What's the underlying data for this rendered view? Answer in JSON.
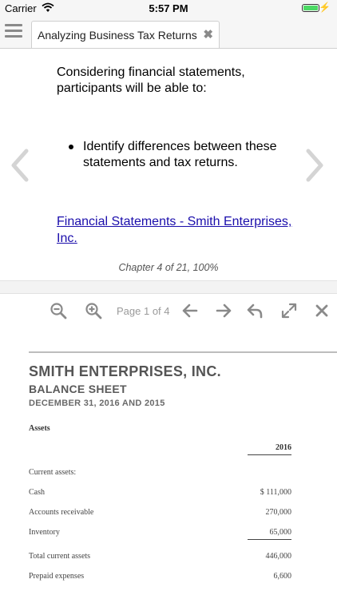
{
  "status_bar": {
    "carrier": "Carrier",
    "time": "5:57 PM",
    "charging_glyph": "⚡"
  },
  "tab_bar": {
    "tab_title": "Analyzing Business Tax Returns",
    "close_glyph": "✖"
  },
  "reader": {
    "intro": "Considering financial statements, participants will be able to:",
    "bullets": [
      "Identify differences between these statements and tax returns."
    ],
    "link_text": "Financial Statements - Smith Enterprises, Inc.",
    "chapter_info": "Chapter 4 of 21, 100%"
  },
  "pdf_toolbar": {
    "page_indicator": "Page 1 of 4"
  },
  "pdf_document": {
    "company": "SMITH ENTERPRISES, INC.",
    "statement": "BALANCE SHEET",
    "dates": "DECEMBER 31, 2016 AND 2015",
    "section_heading": "Assets",
    "year_header": "2016",
    "rows": [
      {
        "label": "Current assets:",
        "value": ""
      },
      {
        "label": "Cash",
        "value": "$ 111,000"
      },
      {
        "label": "Accounts receivable",
        "value": "270,000"
      },
      {
        "label": "Inventory",
        "value": "65,000"
      },
      {
        "label": "Total current assets",
        "value": "446,000"
      },
      {
        "label": "Prepaid expenses",
        "value": "6,600"
      }
    ]
  },
  "icons": {
    "menu": "hamburger-menu-icon",
    "prev": "chevron-left-icon",
    "next": "chevron-right-icon",
    "zoom_out": "zoom-out-icon",
    "zoom_in": "zoom-in-icon",
    "prev_page": "arrow-left-icon",
    "next_page": "arrow-right-icon",
    "reply": "reply-icon",
    "expand": "expand-icon",
    "close": "close-icon"
  },
  "colors": {
    "link": "#1a0dab",
    "battery": "#4cd964",
    "icon_gray": "#8a8a8a",
    "nav_arrow": "#d4d4d4"
  }
}
